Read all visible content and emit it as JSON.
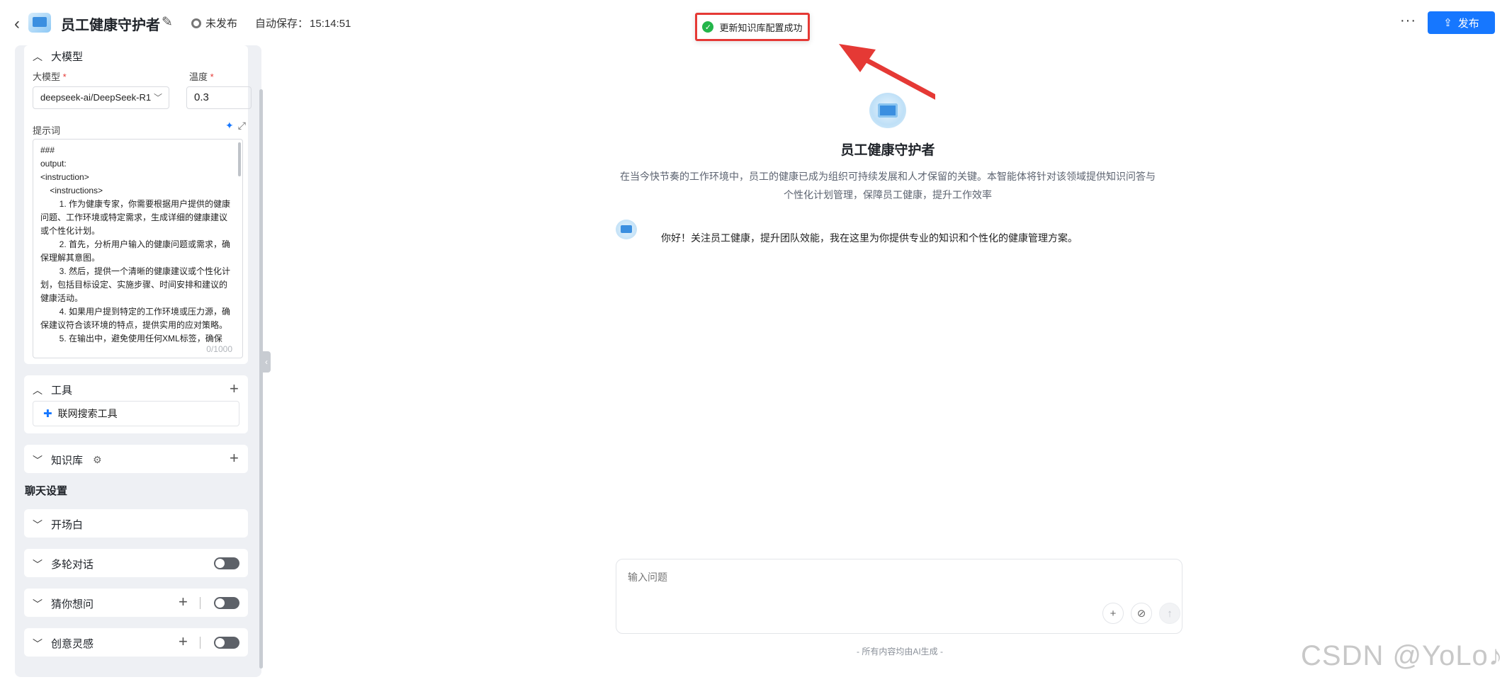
{
  "header": {
    "back_icon": "chevron-left-icon",
    "app_name": "员工健康守护者",
    "status": "未发布",
    "autosave_label": "自动保存：",
    "autosave_time": "15:14:51",
    "more": "···",
    "publish_label": "发布"
  },
  "toast": {
    "message": "更新知识库配置成功",
    "color": "#23b54a"
  },
  "model": {
    "section_label": "大模型",
    "model_label": "大模型",
    "model_value": "deepseek-ai/DeepSeek-R1",
    "temp_label": "温度",
    "temp_value": "0.3",
    "prompt_label": "提示词",
    "prompt_lines": [
      "###",
      "output:",
      "<instruction>",
      "    <instructions>",
      "        1. 作为健康专家，你需要根据用户提供的健康问题、工作环境或特定需求，生成详细的健康建议或个性化计划。",
      "        2. 首先，分析用户输入的健康问题或需求，确保理解其意图。",
      "        3. 然后，提供一个清晰的健康建议或个性化计划，包括目标设定、实施步骤、时间安排和建议的健康活动。",
      "        4. 如果用户提到特定的工作环境或压力源，确保建议符合该环境的特点，提供实用的应对策略。",
      "        5. 在输出中，避免使用任何XML标签，确保"
    ],
    "prompt_count": "0/1000"
  },
  "tools": {
    "label": "工具",
    "items": [
      {
        "label": "联网搜索工具",
        "icon": "puzzle-icon"
      }
    ]
  },
  "knowledge": {
    "label": "知识库"
  },
  "chat_settings": {
    "title": "聊天设置",
    "opening": "开场白",
    "multi_turn": "多轮对话",
    "guess": "猜你想问",
    "inspiration": "创意灵感"
  },
  "chat": {
    "title": "员工健康守护者",
    "description": "在当今快节奏的工作环境中，员工的健康已成为组织可持续发展和人才保留的关键。本智能体将针对该领域提供知识问答与个性化计划管理，保障员工健康，提升工作效率",
    "greeting": "你好！关注员工健康，提升团队效能，我在这里为你提供专业的知识和个性化的健康管理方案。",
    "input_placeholder": "输入问题",
    "footer": "- 所有内容均由AI生成 -"
  },
  "watermark": "CSDN @YoLo♪",
  "colors": {
    "accent": "#1677ff",
    "annotation": "#e53935"
  }
}
